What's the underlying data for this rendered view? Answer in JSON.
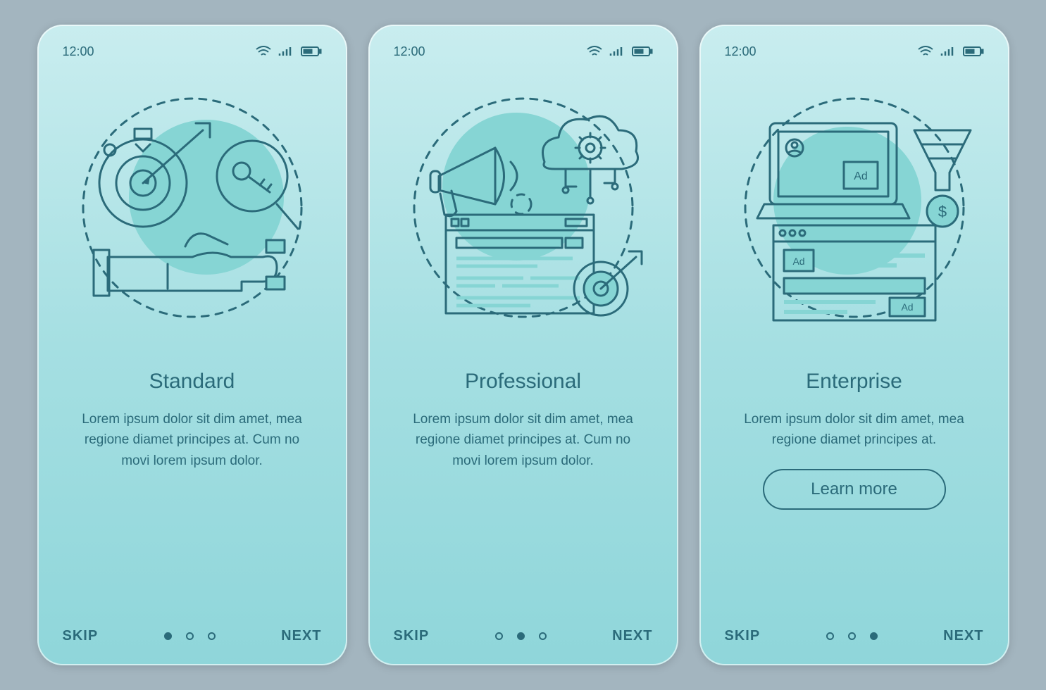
{
  "status": {
    "time": "12:00"
  },
  "nav": {
    "skip": "SKIP",
    "next": "NEXT"
  },
  "screens": [
    {
      "title": "Standard",
      "description": "Lorem ipsum dolor sit dim amet, mea regione diamet principes at. Cum no movi lorem ipsum dolor.",
      "activeDot": 0,
      "cta": null,
      "illustration": "standard"
    },
    {
      "title": "Professional",
      "description": "Lorem ipsum dolor sit dim amet, mea regione diamet principes at. Cum no movi lorem ipsum dolor.",
      "activeDot": 1,
      "cta": null,
      "illustration": "professional"
    },
    {
      "title": "Enterprise",
      "description": "Lorem ipsum dolor sit dim amet, mea regione diamet principes at.",
      "activeDot": 2,
      "cta": "Learn more",
      "illustration": "enterprise"
    }
  ],
  "colors": {
    "accent": "#2b6b7a",
    "bg_start": "#c9edef",
    "bg_end": "#8fd6da",
    "page": "#a3b5bf"
  },
  "icons": {
    "standard": [
      "stopwatch-target-icon",
      "arrow-icon",
      "magnifier-key-icon",
      "hand-magnet-icon"
    ],
    "professional": [
      "megaphone-icon",
      "cloud-gear-icon",
      "browser-search-icon",
      "target-arrow-icon"
    ],
    "enterprise": [
      "laptop-profile-icon",
      "funnel-coin-icon",
      "browser-ads-icon"
    ]
  }
}
